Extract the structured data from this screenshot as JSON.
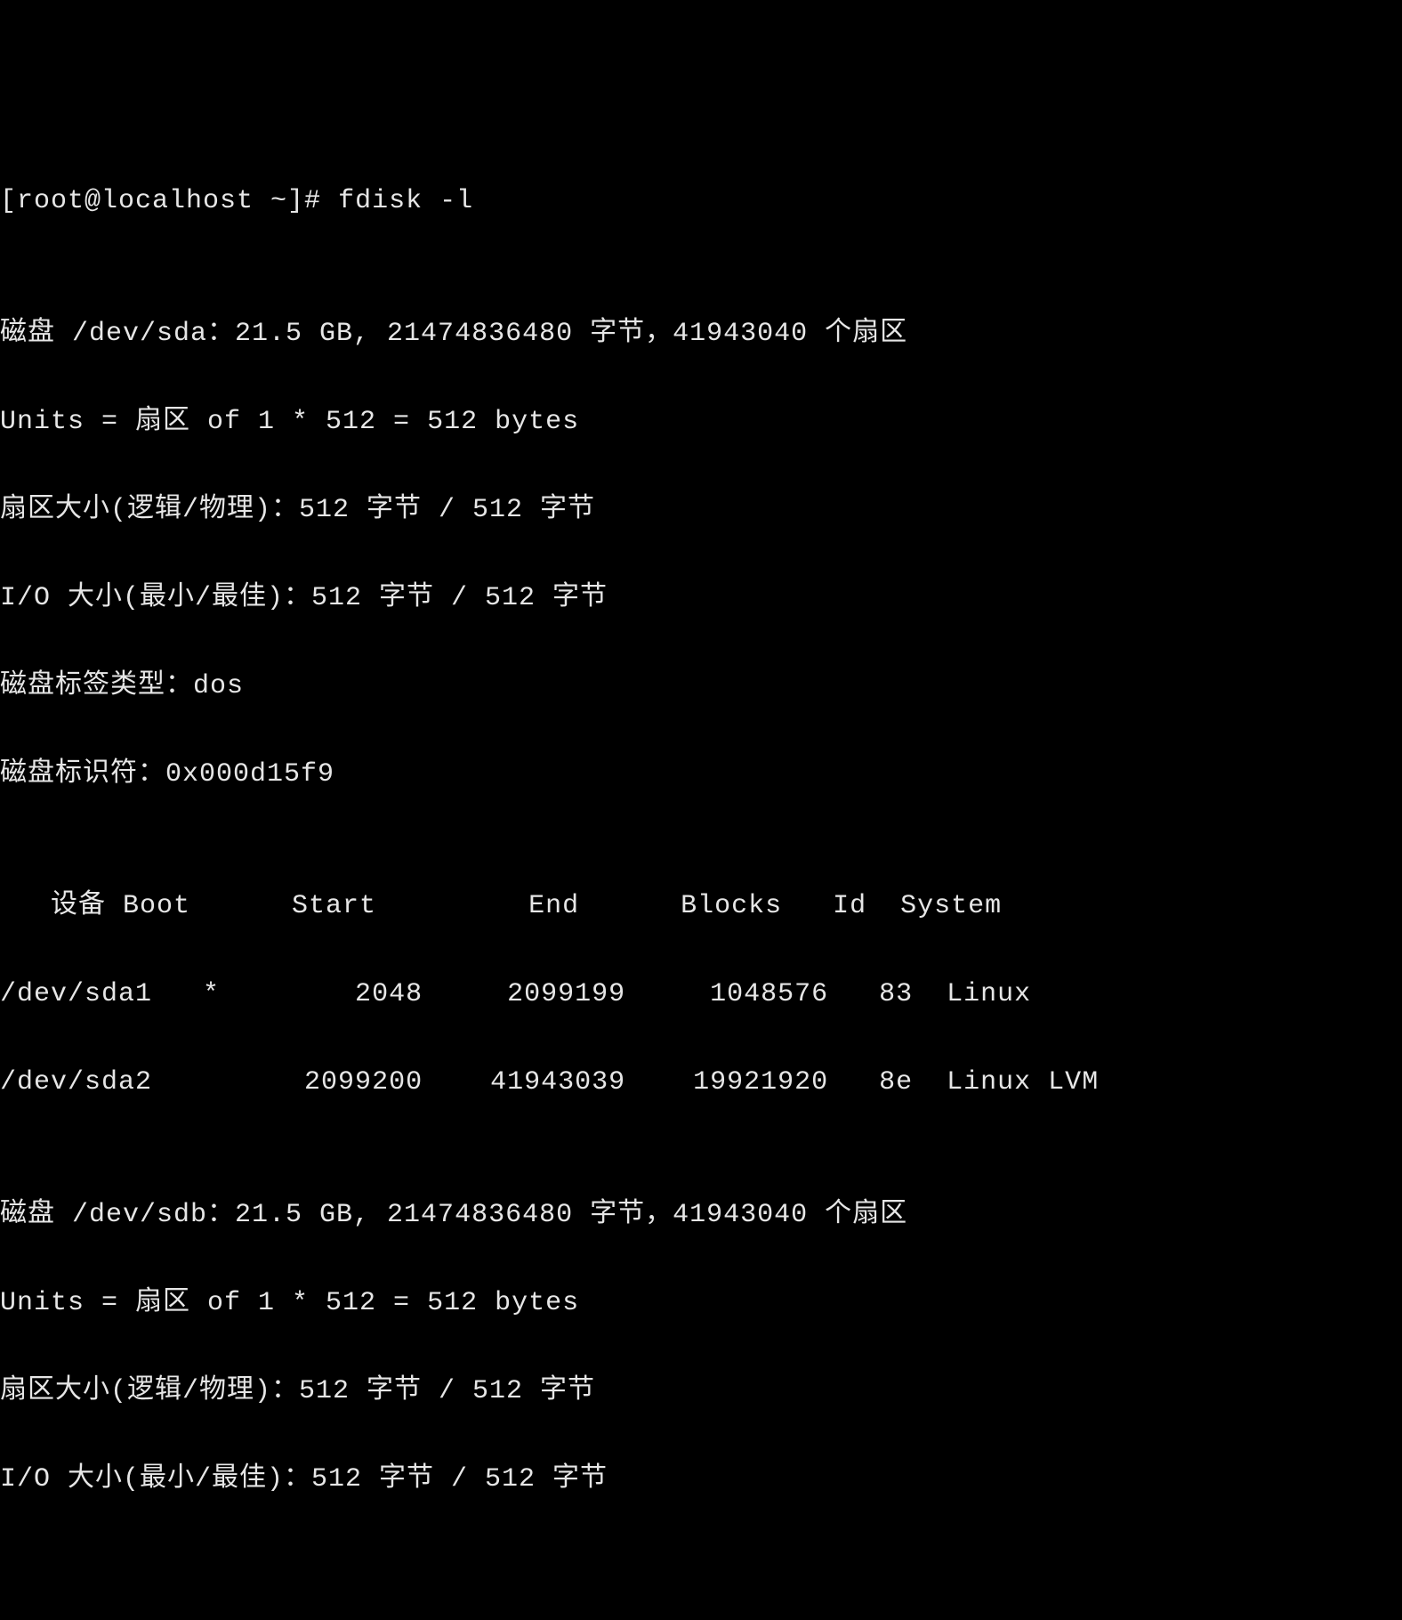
{
  "prompt": "[root@localhost ~]# ",
  "command": "fdisk -l",
  "blank1": "",
  "disk_sda_line": "磁盘 /dev/sda：21.5 GB, 21474836480 字节，41943040 个扇区",
  "units_line": "Units = 扇区 of 1 * 512 = 512 bytes",
  "sector_size_line": "扇区大小(逻辑/物理)：512 字节 / 512 字节",
  "io_size_line": "I/O 大小(最小/最佳)：512 字节 / 512 字节",
  "disk_label_line": "磁盘标签类型：dos",
  "disk_id_line": "磁盘标识符：0x000d15f9",
  "blank2": "",
  "table_header": "   设备 Boot      Start         End      Blocks   Id  System",
  "partition1": "/dev/sda1   *        2048     2099199     1048576   83  Linux",
  "partition2": "/dev/sda2         2099200    41943039    19921920   8e  Linux LVM",
  "blank3": "",
  "disk_sdb_line": "磁盘 /dev/sdb：21.5 GB, 21474836480 字节，41943040 个扇区",
  "units_line2": "Units = 扇区 of 1 * 512 = 512 bytes",
  "sector_size_line2": "扇区大小(逻辑/物理)：512 字节 / 512 字节",
  "io_size_line2": "I/O 大小(最小/最佳)：512 字节 / 512 字节"
}
